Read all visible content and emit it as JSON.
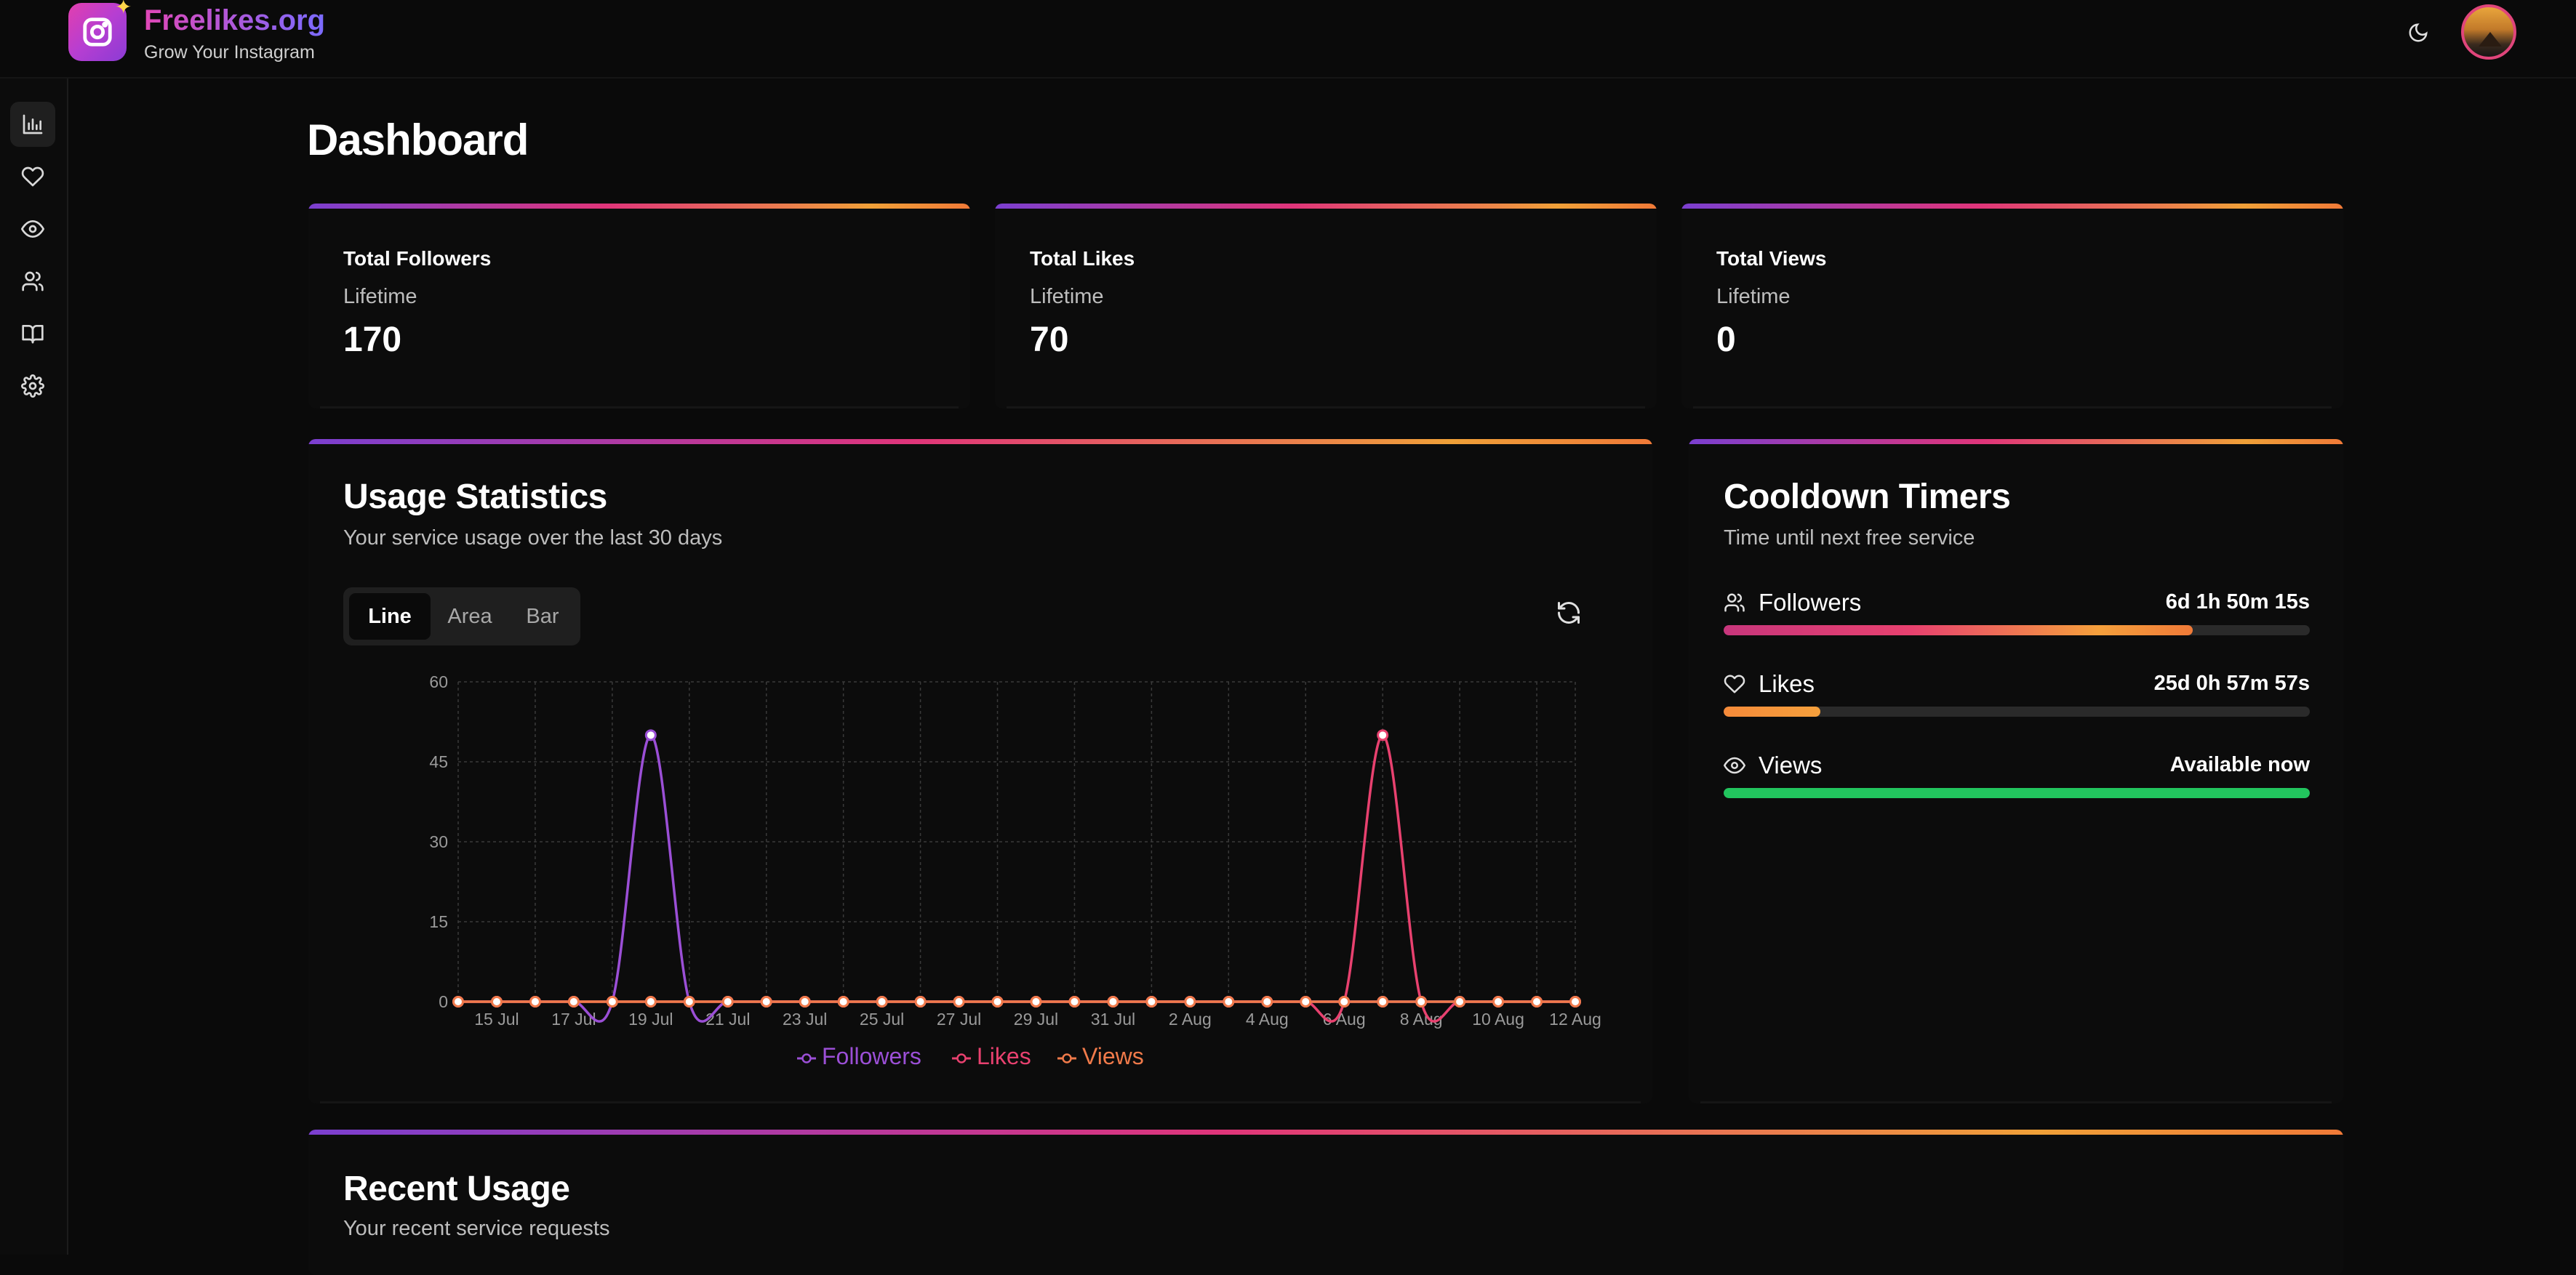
{
  "brand": {
    "name": "Freelikes.org",
    "tagline": "Grow Your Instagram",
    "logo_icon": "instagram-icon"
  },
  "header": {
    "theme_icon": "moon-icon",
    "avatar": "user-avatar"
  },
  "sidebar": {
    "items": [
      {
        "icon": "bar-chart-icon",
        "active": true
      },
      {
        "icon": "heart-icon",
        "active": false
      },
      {
        "icon": "eye-icon",
        "active": false
      },
      {
        "icon": "users-icon",
        "active": false
      },
      {
        "icon": "book-icon",
        "active": false
      },
      {
        "icon": "gear-icon",
        "active": false
      }
    ]
  },
  "page": {
    "title": "Dashboard"
  },
  "stats": [
    {
      "title": "Total Followers",
      "sub": "Lifetime",
      "value": "170"
    },
    {
      "title": "Total Likes",
      "sub": "Lifetime",
      "value": "70"
    },
    {
      "title": "Total Views",
      "sub": "Lifetime",
      "value": "0"
    }
  ],
  "usage": {
    "title": "Usage Statistics",
    "subtitle": "Your service usage over the last 30 days",
    "chart_types": [
      "Line",
      "Area",
      "Bar"
    ],
    "selected_chart_type": "Line",
    "refresh_icon": "refresh-icon"
  },
  "chart_data": {
    "type": "line",
    "x": [
      "14 Jul",
      "15 Jul",
      "16 Jul",
      "17 Jul",
      "18 Jul",
      "19 Jul",
      "20 Jul",
      "21 Jul",
      "22 Jul",
      "23 Jul",
      "24 Jul",
      "25 Jul",
      "26 Jul",
      "27 Jul",
      "28 Jul",
      "29 Jul",
      "30 Jul",
      "31 Jul",
      "1 Aug",
      "2 Aug",
      "3 Aug",
      "4 Aug",
      "5 Aug",
      "6 Aug",
      "7 Aug",
      "8 Aug",
      "9 Aug",
      "10 Aug",
      "11 Aug",
      "12 Aug"
    ],
    "x_tick_labels": [
      "15 Jul",
      "17 Jul",
      "19 Jul",
      "21 Jul",
      "23 Jul",
      "25 Jul",
      "27 Jul",
      "29 Jul",
      "31 Jul",
      "2 Aug",
      "4 Aug",
      "6 Aug",
      "8 Aug",
      "10 Aug",
      "12 Aug"
    ],
    "y_ticks": [
      "0",
      "15",
      "30",
      "45",
      "60"
    ],
    "ylim": [
      0,
      60
    ],
    "grid": true,
    "legend_position": "bottom",
    "series": [
      {
        "name": "Followers",
        "color": "#9b4fd6",
        "values": [
          0,
          0,
          0,
          0,
          0,
          50,
          0,
          0,
          0,
          0,
          0,
          0,
          0,
          0,
          0,
          0,
          0,
          0,
          0,
          0,
          0,
          0,
          0,
          0,
          0,
          0,
          0,
          0,
          0,
          0
        ]
      },
      {
        "name": "Likes",
        "color": "#e8416f",
        "values": [
          0,
          0,
          0,
          0,
          0,
          0,
          0,
          0,
          0,
          0,
          0,
          0,
          0,
          0,
          0,
          0,
          0,
          0,
          0,
          0,
          0,
          0,
          0,
          0,
          50,
          0,
          0,
          0,
          0,
          0
        ]
      },
      {
        "name": "Views",
        "color": "#f07a4a",
        "values": [
          0,
          0,
          0,
          0,
          0,
          0,
          0,
          0,
          0,
          0,
          0,
          0,
          0,
          0,
          0,
          0,
          0,
          0,
          0,
          0,
          0,
          0,
          0,
          0,
          0,
          0,
          0,
          0,
          0,
          0
        ]
      }
    ]
  },
  "cooldown": {
    "title": "Cooldown Timers",
    "subtitle": "Time until next free service",
    "rows": [
      {
        "label": "Followers",
        "icon": "users-icon",
        "time": "6d 1h 50m 15s",
        "progress": 0.8
      },
      {
        "label": "Likes",
        "icon": "heart-icon",
        "time": "25d 0h 57m 57s",
        "progress": 0.165
      },
      {
        "label": "Views",
        "icon": "eye-icon",
        "time": "Available now",
        "progress": 1.0
      }
    ]
  },
  "recent": {
    "title": "Recent Usage",
    "subtitle": "Your recent service requests"
  }
}
